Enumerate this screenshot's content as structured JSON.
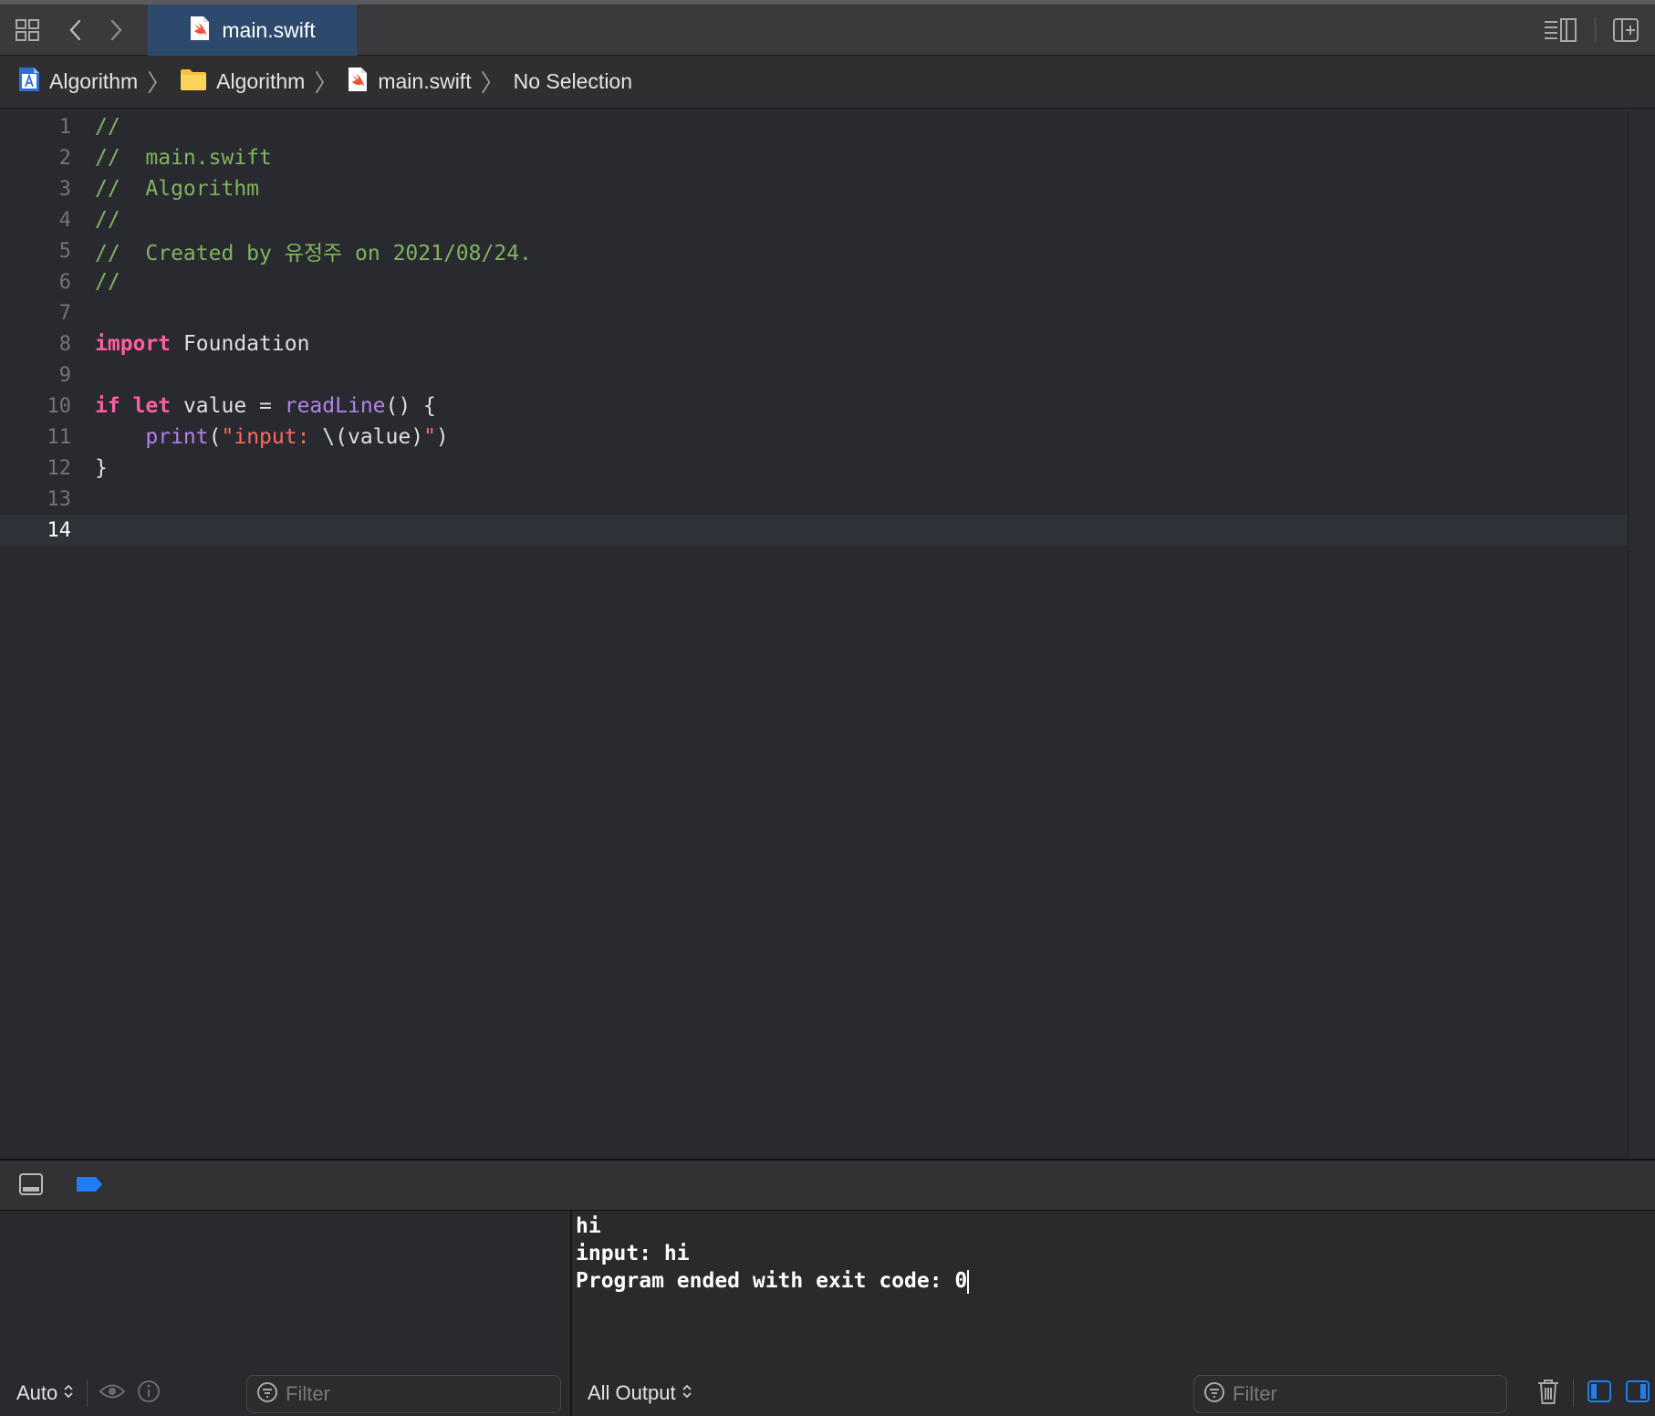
{
  "tab": {
    "label": "main.swift"
  },
  "breadcrumb": {
    "items": [
      "Algorithm",
      "Algorithm",
      "main.swift",
      "No Selection"
    ]
  },
  "editor": {
    "line_numbers": [
      "1",
      "2",
      "3",
      "4",
      "5",
      "6",
      "7",
      "8",
      "9",
      "10",
      "11",
      "12",
      "13",
      "14"
    ],
    "lines": {
      "l1": "//",
      "l2": "//  main.swift",
      "l3": "//  Algorithm",
      "l4": "//",
      "l5": "//  Created by 유정주 on 2021/08/24.",
      "l6": "//",
      "l8_kw": "import",
      "l8_rest": " Foundation",
      "l10_if": "if",
      "l10_let": "let",
      "l10_mid": " value = ",
      "l10_fn": "readLine",
      "l10_end": "() {",
      "l11_indent": "    ",
      "l11_fn": "print",
      "l11_open": "(",
      "l11_str1": "\"input: ",
      "l11_interp": "\\(value)",
      "l11_str2": "\"",
      "l11_close": ")",
      "l12": "}"
    },
    "current_line": 14
  },
  "console": {
    "lines": [
      "hi",
      "input: hi",
      "Program ended with exit code: 0"
    ]
  },
  "variables_pane": {
    "scope_label": "Auto",
    "filter_placeholder": "Filter"
  },
  "console_pane": {
    "output_label": "All Output",
    "filter_placeholder": "Filter"
  },
  "colors": {
    "comment": "#7fb55f",
    "keyword": "#fc5fa3",
    "function": "#b281eb",
    "string": "#fc6a5d",
    "accent": "#1f7ef2",
    "swift_icon": "#f05138"
  },
  "icons": {
    "grid": "grid-icon",
    "back": "chevron-left-icon",
    "forward": "chevron-right-icon",
    "swift": "swift-file-icon",
    "project": "xcode-project-icon",
    "folder": "folder-icon",
    "inspector": "inspector-icon",
    "add_editor": "add-editor-icon",
    "hide_debug": "hide-debug-area-icon",
    "breakpoint": "breakpoint-icon",
    "eye": "eye-icon",
    "info": "info-icon",
    "trash": "trash-icon"
  }
}
